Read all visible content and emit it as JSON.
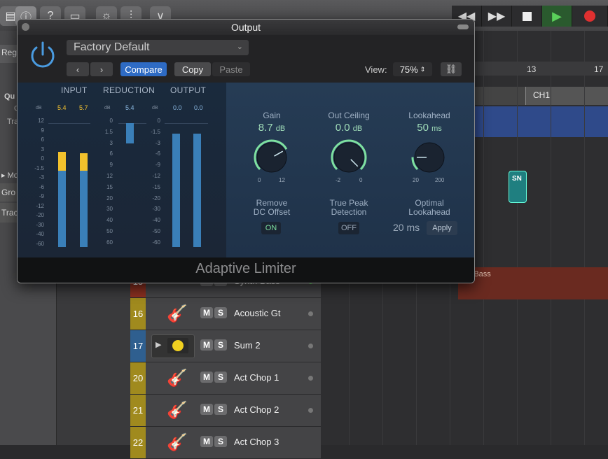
{
  "toolbar": {
    "icons": [
      "library-icon",
      "info-icon",
      "help-icon",
      "editors-icon",
      "smart-controls-icon",
      "mixer-icon",
      "editors2-icon"
    ],
    "transport": [
      "rewind",
      "fast-forward",
      "stop",
      "play",
      "record"
    ]
  },
  "inspector": {
    "items": [
      "Reg",
      "Qu",
      "C",
      "Tra",
      "Mo",
      "Gro",
      "Trac"
    ]
  },
  "ruler": {
    "marks": [
      "13",
      "17"
    ]
  },
  "regions": {
    "ch1": "CH1",
    "snare": "SN",
    "synth_bass": "nth Bass"
  },
  "tracks": [
    {
      "num": "15",
      "name": "Synth Bass",
      "color": "#8a2f20"
    },
    {
      "num": "16",
      "name": "Acoustic Gt",
      "color": "#a08a1e"
    },
    {
      "num": "17",
      "name": "Sum 2",
      "color": "#2f5f8f"
    },
    {
      "num": "20",
      "name": "Act Chop 1",
      "color": "#a08a1e"
    },
    {
      "num": "21",
      "name": "Act Chop 2",
      "color": "#a08a1e"
    },
    {
      "num": "22",
      "name": "Act Chop 3",
      "color": "#a08a1e"
    }
  ],
  "ms": {
    "mute": "M",
    "solo": "S"
  },
  "plugin": {
    "window_title": "Output",
    "preset": "Factory Default",
    "compare": "Compare",
    "copy": "Copy",
    "paste": "Paste",
    "view_label": "View:",
    "view_value": "75%",
    "name": "Adaptive Limiter",
    "meters": {
      "input_label": "INPUT",
      "reduction_label": "REDUCTION",
      "output_label": "OUTPUT",
      "input_peaks": [
        "5.4",
        "5.7"
      ],
      "reduction_peak": "5.4",
      "output_peaks": [
        "0.0",
        "0.0"
      ],
      "db": "dB",
      "input_scale": [
        "12",
        "9",
        "6",
        "3",
        "0",
        "-1.5",
        "-3",
        "-6",
        "-9",
        "-12",
        "-20",
        "-30",
        "-40",
        "-60"
      ],
      "reduction_scale": [
        "0",
        "1.5",
        "3",
        "6",
        "9",
        "12",
        "15",
        "20",
        "30",
        "40",
        "50",
        "60"
      ],
      "output_scale": [
        "0",
        "-1.5",
        "-3",
        "-6",
        "-9",
        "-12",
        "-15",
        "-20",
        "-30",
        "-40",
        "-50",
        "-60"
      ]
    },
    "gain": {
      "label": "Gain",
      "value": "8.7",
      "unit": "dB",
      "min": "0",
      "max": "12",
      "level": 0.725
    },
    "ceiling": {
      "label": "Out Ceiling",
      "value": "0.0",
      "unit": "dB",
      "min": "-2",
      "max": "0",
      "level": 1.0
    },
    "lookahead": {
      "label": "Lookahead",
      "value": "50",
      "unit": "ms",
      "min": "20",
      "max": "200",
      "level": 0.17
    },
    "dc": {
      "label1": "Remove",
      "label2": "DC Offset",
      "state": "ON"
    },
    "truepeak": {
      "label1": "True Peak",
      "label2": "Detection",
      "state": "OFF"
    },
    "optimal": {
      "label1": "Optimal",
      "label2": "Lookahead",
      "value": "20 ms",
      "apply": "Apply"
    }
  }
}
